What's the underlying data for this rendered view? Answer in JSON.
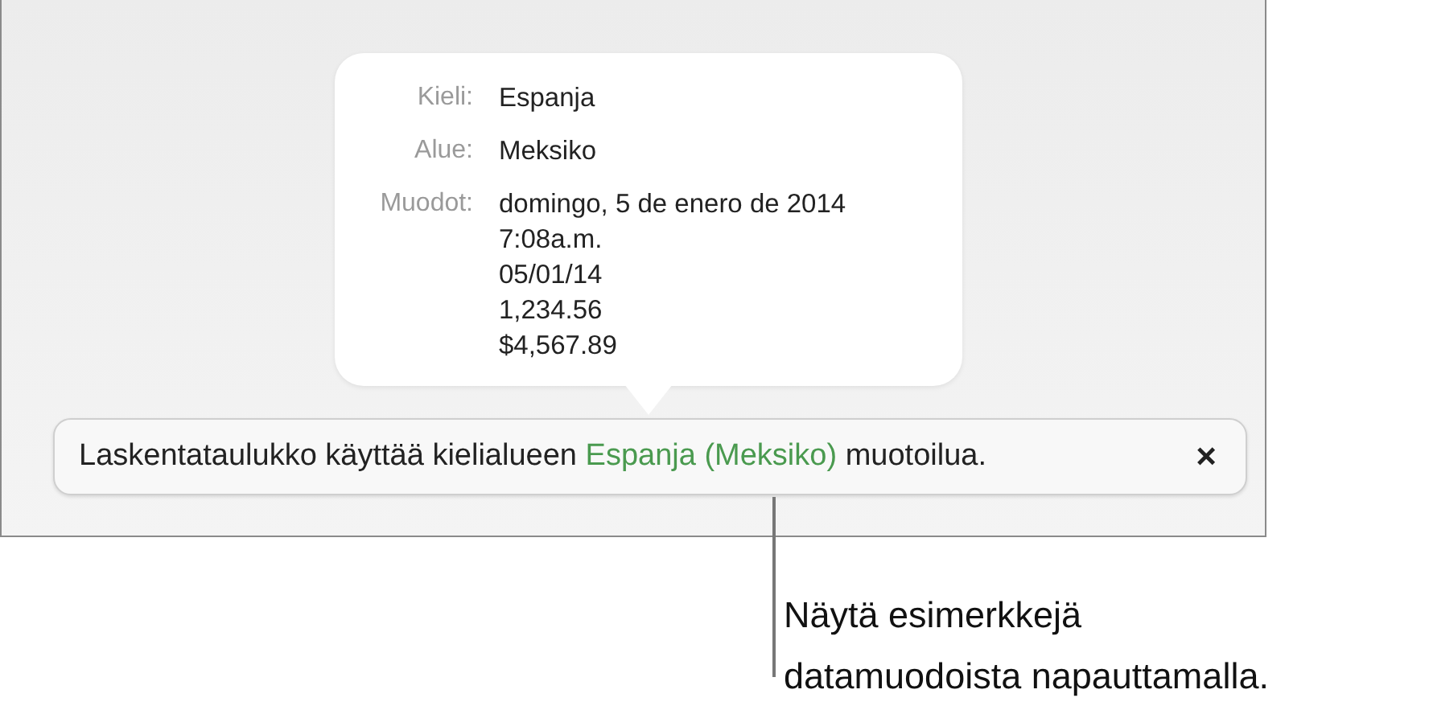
{
  "popover": {
    "rows": [
      {
        "label": "Kieli:",
        "values": [
          "Espanja"
        ]
      },
      {
        "label": "Alue:",
        "values": [
          "Meksiko"
        ]
      },
      {
        "label": "Muodot:",
        "values": [
          "domingo, 5 de enero de 2014",
          "7:08a.m.",
          "05/01/14",
          "1,234.56",
          "$4,567.89"
        ]
      }
    ]
  },
  "banner": {
    "before": "Laskentataulukko käyttää kielialueen",
    "link": "Espanja (Meksiko)",
    "after": "muotoilua.",
    "close": "×"
  },
  "callout": "Näytä esimerkkejä\ndatamuodoista napauttamalla."
}
